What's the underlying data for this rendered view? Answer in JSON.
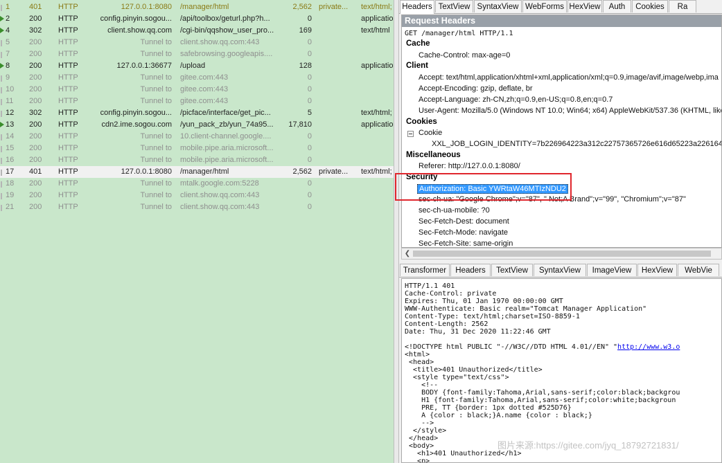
{
  "sessions": [
    {
      "num": "1",
      "result": "401",
      "protocol": "HTTP",
      "host": "127.0.0.1:8080",
      "url": "/manager/html",
      "body": "2,562",
      "caching": "private...",
      "ctype": "text/html;",
      "style": "c-olive",
      "icon": "tick"
    },
    {
      "num": "2",
      "result": "200",
      "protocol": "HTTP",
      "host": "config.pinyin.sogou...",
      "url": "/api/toolbox/geturl.php?h...",
      "body": "0",
      "caching": "",
      "ctype": "application",
      "style": "",
      "icon": "arrow"
    },
    {
      "num": "4",
      "result": "302",
      "protocol": "HTTP",
      "host": "client.show.qq.com",
      "url": "/cgi-bin/qqshow_user_pro...",
      "body": "169",
      "caching": "",
      "ctype": "text/html",
      "style": "",
      "icon": "arrow"
    },
    {
      "num": "5",
      "result": "200",
      "protocol": "HTTP",
      "host": "Tunnel to",
      "url": "client.show.qq.com:443",
      "body": "0",
      "caching": "",
      "ctype": "",
      "style": "tunnel",
      "icon": "tick"
    },
    {
      "num": "7",
      "result": "200",
      "protocol": "HTTP",
      "host": "Tunnel to",
      "url": "safebrowsing.googleapis....",
      "body": "0",
      "caching": "",
      "ctype": "",
      "style": "tunnel",
      "icon": "tick"
    },
    {
      "num": "8",
      "result": "200",
      "protocol": "HTTP",
      "host": "127.0.0.1:36677",
      "url": "/upload",
      "body": "128",
      "caching": "",
      "ctype": "application",
      "style": "",
      "icon": "arrow"
    },
    {
      "num": "9",
      "result": "200",
      "protocol": "HTTP",
      "host": "Tunnel to",
      "url": "gitee.com:443",
      "body": "0",
      "caching": "",
      "ctype": "",
      "style": "tunnel",
      "icon": "tick"
    },
    {
      "num": "10",
      "result": "200",
      "protocol": "HTTP",
      "host": "Tunnel to",
      "url": "gitee.com:443",
      "body": "0",
      "caching": "",
      "ctype": "",
      "style": "tunnel",
      "icon": "tick"
    },
    {
      "num": "11",
      "result": "200",
      "protocol": "HTTP",
      "host": "Tunnel to",
      "url": "gitee.com:443",
      "body": "0",
      "caching": "",
      "ctype": "",
      "style": "tunnel",
      "icon": "tick"
    },
    {
      "num": "12",
      "result": "302",
      "protocol": "HTTP",
      "host": "config.pinyin.sogou...",
      "url": "/picface/interface/get_pic...",
      "body": "5",
      "caching": "",
      "ctype": "text/html;",
      "style": "",
      "icon": "tick"
    },
    {
      "num": "13",
      "result": "200",
      "protocol": "HTTP",
      "host": "cdn2.ime.sogou.com",
      "url": "/yun_pack_zb/yun_74a95...",
      "body": "17,810",
      "caching": "",
      "ctype": "application",
      "style": "",
      "icon": "arrow"
    },
    {
      "num": "14",
      "result": "200",
      "protocol": "HTTP",
      "host": "Tunnel to",
      "url": "10.client-channel.google....",
      "body": "0",
      "caching": "",
      "ctype": "",
      "style": "tunnel",
      "icon": "tick"
    },
    {
      "num": "15",
      "result": "200",
      "protocol": "HTTP",
      "host": "Tunnel to",
      "url": "mobile.pipe.aria.microsoft...",
      "body": "0",
      "caching": "",
      "ctype": "",
      "style": "tunnel",
      "icon": "tick"
    },
    {
      "num": "16",
      "result": "200",
      "protocol": "HTTP",
      "host": "Tunnel to",
      "url": "mobile.pipe.aria.microsoft...",
      "body": "0",
      "caching": "",
      "ctype": "",
      "style": "tunnel",
      "icon": "tick"
    },
    {
      "num": "17",
      "result": "401",
      "protocol": "HTTP",
      "host": "127.0.0.1:8080",
      "url": "/manager/html",
      "body": "2,562",
      "caching": "private...",
      "ctype": "text/html;",
      "style": "sel",
      "icon": "tick"
    },
    {
      "num": "18",
      "result": "200",
      "protocol": "HTTP",
      "host": "Tunnel to",
      "url": "mtalk.google.com:5228",
      "body": "0",
      "caching": "",
      "ctype": "",
      "style": "tunnel",
      "icon": "tick"
    },
    {
      "num": "19",
      "result": "200",
      "protocol": "HTTP",
      "host": "Tunnel to",
      "url": "client.show.qq.com:443",
      "body": "0",
      "caching": "",
      "ctype": "",
      "style": "tunnel",
      "icon": "tick"
    },
    {
      "num": "21",
      "result": "200",
      "protocol": "HTTP",
      "host": "Tunnel to",
      "url": "client.show.qq.com:443",
      "body": "0",
      "caching": "",
      "ctype": "",
      "style": "tunnel",
      "icon": "tick"
    }
  ],
  "request_tabs": [
    "Headers",
    "TextView",
    "SyntaxView",
    "WebForms",
    "HexView",
    "Auth",
    "Cookies",
    "Ra"
  ],
  "request": {
    "title": "Request Headers",
    "request_line": "GET /manager/html HTTP/1.1",
    "cache_section": "Cache",
    "cache_control": "Cache-Control: max-age=0",
    "client_section": "Client",
    "accept": "Accept: text/html,application/xhtml+xml,application/xml;q=0.9,image/avif,image/webp,ima",
    "accept_encoding": "Accept-Encoding: gzip, deflate, br",
    "accept_language": "Accept-Language: zh-CN,zh;q=0.9,en-US;q=0.8,en;q=0.7",
    "user_agent": "User-Agent: Mozilla/5.0 (Windows NT 10.0; Win64; x64) AppleWebKit/537.36 (KHTML, like G",
    "cookies_section": "Cookies",
    "cookie_label": "Cookie",
    "cookie_value": "XXL_JOB_LOGIN_IDENTITY=7b226964223a312c22757365726e616d65223a2261646d",
    "misc_section": "Miscellaneous",
    "referer": "Referer: http://127.0.0.1:8080/",
    "security_section": "Security",
    "authorization": "Authorization: Basic YWRtaW46MTIzNDU2",
    "sec_ch_ua": "sec-ch-ua: \"Google Chrome\";v=\"87\", \" Not;A Brand\";v=\"99\", \"Chromium\";v=\"87\"",
    "sec_ch_ua_mobile": "sec-ch-ua-mobile: ?0",
    "sec_fetch_dest": "Sec-Fetch-Dest: document",
    "sec_fetch_mode": "Sec-Fetch-Mode: navigate",
    "sec_fetch_site": "Sec-Fetch-Site: same-origin"
  },
  "scroll_left_glyph": "❮",
  "response_tabs": [
    "Transformer",
    "Headers",
    "TextView",
    "SyntaxView",
    "ImageView",
    "HexView",
    "WebVie"
  ],
  "response": {
    "lines": [
      "HTTP/1.1 401",
      "Cache-Control: private",
      "Expires: Thu, 01 Jan 1970 00:00:00 GMT",
      "WWW-Authenticate: Basic realm=\"Tomcat Manager Application\"",
      "Content-Type: text/html;charset=ISO-8859-1",
      "Content-Length: 2562",
      "Date: Thu, 31 Dec 2020 11:22:46 GMT",
      ""
    ],
    "doctype_prefix": "<!DOCTYPE html PUBLIC \"-//W3C//DTD HTML 4.01//EN\" \"",
    "doctype_link": "http://www.w3.o",
    "body_lines": [
      "<html>",
      " <head>",
      "  <title>401 Unauthorized</title>",
      "  <style type=\"text/css\">",
      "    <!--",
      "    BODY {font-family:Tahoma,Arial,sans-serif;color:black;backgrou",
      "    H1 {font-family:Tahoma,Arial,sans-serif;color:white;backgroun",
      "    PRE, TT {border: 1px dotted #525D76}",
      "    A {color : black;}A.name {color : black;}",
      "    -->",
      "  </style>",
      " </head>",
      " <body>",
      "   <h1>401 Unauthorized</h1>",
      "   <p>"
    ]
  },
  "watermark": "图片来源:https://gitee.com/jyq_18792721831/"
}
